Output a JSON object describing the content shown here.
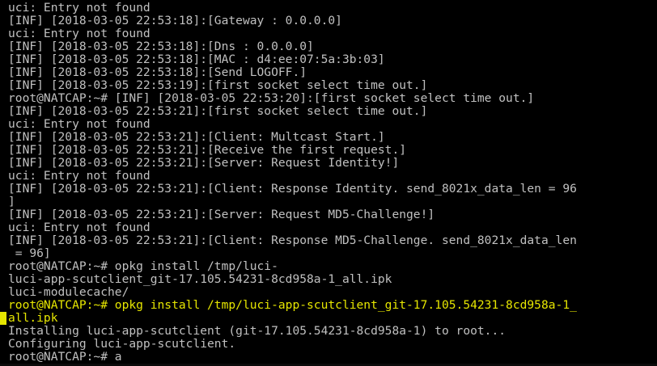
{
  "terminal": {
    "colors": {
      "background": "#000000",
      "text": "#c0c0c0",
      "highlight": "#e6e600"
    },
    "lines": [
      {
        "text": "uci: Entry not found",
        "style": "normal"
      },
      {
        "text": "[INF] [2018-03-05 22:53:18]:[Gateway : 0.0.0.0]",
        "style": "normal"
      },
      {
        "text": "uci: Entry not found",
        "style": "normal"
      },
      {
        "text": "[INF] [2018-03-05 22:53:18]:[Dns : 0.0.0.0]",
        "style": "normal"
      },
      {
        "text": "[INF] [2018-03-05 22:53:18]:[MAC : d4:ee:07:5a:3b:03]",
        "style": "normal"
      },
      {
        "text": "[INF] [2018-03-05 22:53:18]:[Send LOGOFF.]",
        "style": "normal"
      },
      {
        "text": "[INF] [2018-03-05 22:53:19]:[first socket select time out.]",
        "style": "normal"
      },
      {
        "text": "root@NATCAP:~# [INF] [2018-03-05 22:53:20]:[first socket select time out.]",
        "style": "normal"
      },
      {
        "text": "[INF] [2018-03-05 22:53:21]:[first socket select time out.]",
        "style": "normal"
      },
      {
        "text": "uci: Entry not found",
        "style": "normal"
      },
      {
        "text": "[INF] [2018-03-05 22:53:21]:[Client: Multcast Start.]",
        "style": "normal"
      },
      {
        "text": "[INF] [2018-03-05 22:53:21]:[Receive the first request.]",
        "style": "normal"
      },
      {
        "text": "[INF] [2018-03-05 22:53:21]:[Server: Request Identity!]",
        "style": "normal"
      },
      {
        "text": "uci: Entry not found",
        "style": "normal"
      },
      {
        "text": "[INF] [2018-03-05 22:53:21]:[Client: Response Identity. send_8021x_data_len = 96",
        "style": "normal"
      },
      {
        "text": "]",
        "style": "normal"
      },
      {
        "text": "[INF] [2018-03-05 22:53:21]:[Server: Request MD5-Challenge!]",
        "style": "normal"
      },
      {
        "text": "uci: Entry not found",
        "style": "normal"
      },
      {
        "text": "[INF] [2018-03-05 22:53:21]:[Client: Response MD5-Challenge. send_8021x_data_len",
        "style": "normal"
      },
      {
        "text": " = 96]",
        "style": "normal"
      },
      {
        "text": "root@NATCAP:~# opkg install /tmp/luci-",
        "style": "normal"
      },
      {
        "text": "luci-app-scutclient_git-17.105.54231-8cd958a-1_all.ipk",
        "style": "normal"
      },
      {
        "text": "luci-modulecache/",
        "style": "normal"
      },
      {
        "text": "root@NATCAP:~# opkg install /tmp/luci-app-scutclient_git-17.105.54231-8cd958a-1_",
        "style": "highlight"
      },
      {
        "text": "all.ipk",
        "style": "highlight"
      },
      {
        "text": "Installing luci-app-scutclient (git-17.105.54231-8cd958a-1) to root...",
        "style": "normal"
      },
      {
        "text": "Configuring luci-app-scutclient.",
        "style": "normal"
      },
      {
        "text": "root@NATCAP:~# a",
        "style": "normal"
      }
    ]
  }
}
